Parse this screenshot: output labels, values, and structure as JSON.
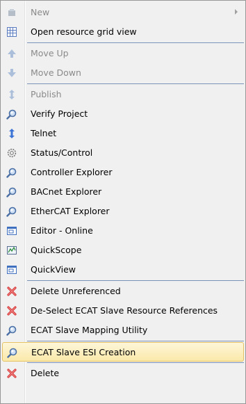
{
  "menu": {
    "items": [
      {
        "label": "New",
        "icon": "new-icon",
        "disabled": true,
        "submenu": true
      },
      {
        "label": "Open resource grid view",
        "icon": "grid-icon"
      },
      {
        "separator": true
      },
      {
        "label": "Move Up",
        "icon": "arrow-up-icon",
        "disabled": true
      },
      {
        "label": "Move Down",
        "icon": "arrow-down-icon",
        "disabled": true
      },
      {
        "separator": true
      },
      {
        "label": "Publish",
        "icon": "publish-icon",
        "disabled": true
      },
      {
        "label": "Verify Project",
        "icon": "magnifier-icon"
      },
      {
        "label": "Telnet",
        "icon": "telnet-icon"
      },
      {
        "label": "Status/Control",
        "icon": "gear-icon"
      },
      {
        "label": "Controller Explorer",
        "icon": "magnifier-icon"
      },
      {
        "label": "BACnet Explorer",
        "icon": "magnifier-icon"
      },
      {
        "label": "EtherCAT Explorer",
        "icon": "magnifier-icon"
      },
      {
        "label": "Editor - Online",
        "icon": "window-icon"
      },
      {
        "label": "QuickScope",
        "icon": "scope-icon"
      },
      {
        "label": "QuickView",
        "icon": "window-icon"
      },
      {
        "separator": true
      },
      {
        "label": "Delete Unreferenced",
        "icon": "red-x-icon"
      },
      {
        "label": "De-Select ECAT Slave Resource References",
        "icon": "red-x-icon"
      },
      {
        "label": "ECAT Slave Mapping Utility",
        "icon": "magnifier-icon"
      },
      {
        "separator": true
      },
      {
        "label": "ECAT Slave ESI Creation",
        "icon": "magnifier-icon",
        "highlighted": true
      },
      {
        "separator": true
      },
      {
        "label": "Delete",
        "icon": "red-x-icon"
      }
    ]
  },
  "colors": {
    "highlight_border": "#e5c365",
    "separator": "#7a93b8",
    "disabled_text": "#8a8a8a"
  }
}
